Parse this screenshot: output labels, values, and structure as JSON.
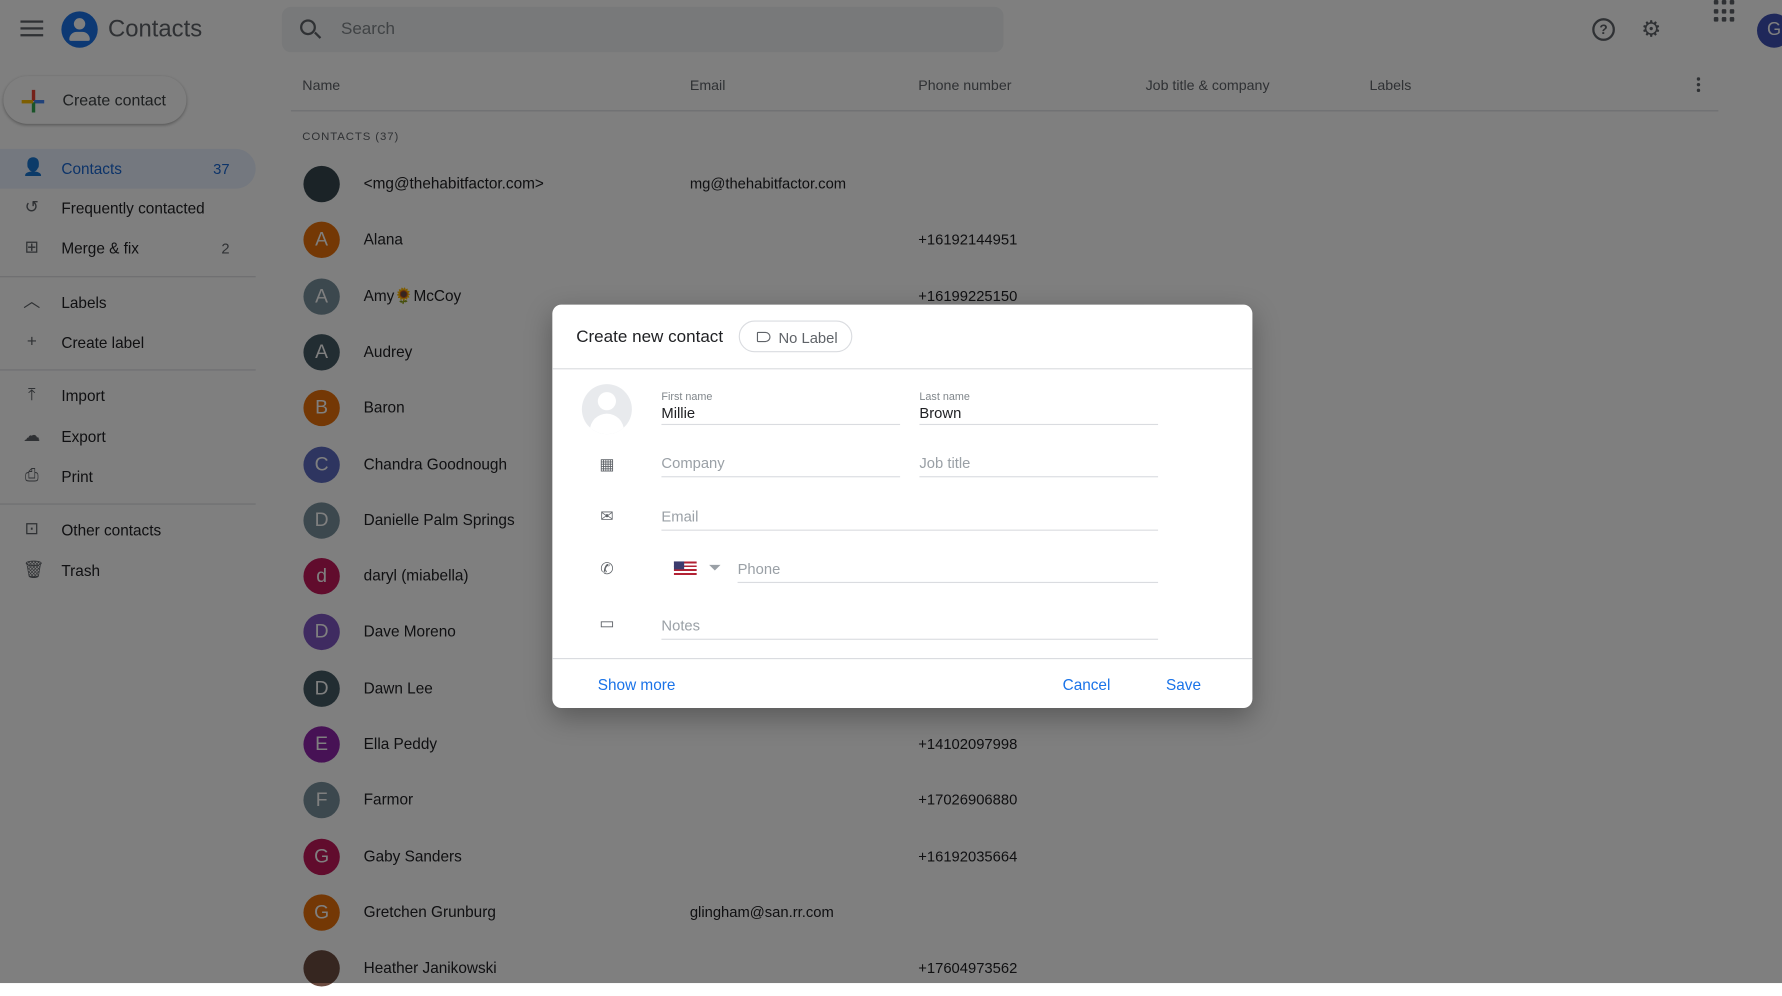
{
  "app": {
    "title": "Contacts",
    "search_placeholder": "Search",
    "account_initial": "G"
  },
  "sidebar": {
    "create_label": "Create contact",
    "items": [
      {
        "label": "Contacts",
        "count": "37",
        "icon": "person-icon"
      },
      {
        "label": "Frequently contacted",
        "count": "",
        "icon": "history-icon"
      },
      {
        "label": "Merge & fix",
        "count": "2",
        "icon": "merge-icon"
      },
      {
        "label": "Labels",
        "count": "",
        "icon": "chevron-up-icon"
      },
      {
        "label": "Create label",
        "count": "",
        "icon": "plus-icon"
      },
      {
        "label": "Import",
        "count": "",
        "icon": "upload-icon"
      },
      {
        "label": "Export",
        "count": "",
        "icon": "cloud-download-icon"
      },
      {
        "label": "Print",
        "count": "",
        "icon": "print-icon"
      },
      {
        "label": "Other contacts",
        "count": "",
        "icon": "archive-icon"
      },
      {
        "label": "Trash",
        "count": "",
        "icon": "trash-icon"
      }
    ]
  },
  "table": {
    "columns": [
      "Name",
      "Email",
      "Phone number",
      "Job title & company",
      "Labels"
    ],
    "section": "CONTACTS (37)",
    "rows": [
      {
        "initial": "",
        "name": "<mg@thehabitfactor.com>",
        "email": "mg@thehabitfactor.com",
        "phone": "",
        "color": "#37474f"
      },
      {
        "initial": "A",
        "name": "Alana",
        "email": "",
        "phone": "+16192144951",
        "color": "#e8710a"
      },
      {
        "initial": "A",
        "name": "Amy🌻McCoy",
        "email": "",
        "phone": "+16199225150",
        "color": "#78909c"
      },
      {
        "initial": "A",
        "name": "Audrey",
        "email": "",
        "phone": "",
        "color": "#455a64"
      },
      {
        "initial": "B",
        "name": "Baron",
        "email": "",
        "phone": "",
        "color": "#e8710a"
      },
      {
        "initial": "C",
        "name": "Chandra Goodnough",
        "email": "",
        "phone": "",
        "color": "#5c6bc0"
      },
      {
        "initial": "D",
        "name": "Danielle Palm Springs",
        "email": "",
        "phone": "",
        "color": "#78909c"
      },
      {
        "initial": "d",
        "name": "daryl (miabella)",
        "email": "",
        "phone": "",
        "color": "#c2185b"
      },
      {
        "initial": "D",
        "name": "Dave Moreno",
        "email": "",
        "phone": "",
        "color": "#7e57c2"
      },
      {
        "initial": "D",
        "name": "Dawn Lee",
        "email": "",
        "phone": "",
        "color": "#455a64"
      },
      {
        "initial": "E",
        "name": "Ella Peddy",
        "email": "",
        "phone": "+14102097998",
        "color": "#8e24aa"
      },
      {
        "initial": "F",
        "name": "Farmor",
        "email": "",
        "phone": "+17026906880",
        "color": "#78909c"
      },
      {
        "initial": "G",
        "name": "Gaby Sanders",
        "email": "",
        "phone": "+16192035664",
        "color": "#c2185b"
      },
      {
        "initial": "G",
        "name": "Gretchen Grunburg",
        "email": "glingham@san.rr.com",
        "phone": "",
        "color": "#e8710a"
      },
      {
        "initial": "",
        "name": "Heather Janikowski",
        "email": "",
        "phone": "+17604973562",
        "color": "#6d4c41"
      }
    ]
  },
  "dialog": {
    "title": "Create new contact",
    "label_chip": "No Label",
    "first_name_label": "First name",
    "first_name": "Millie",
    "last_name_label": "Last name",
    "last_name": "Brown",
    "company_placeholder": "Company",
    "job_title_placeholder": "Job title",
    "email_placeholder": "Email",
    "phone_placeholder": "Phone",
    "country": "US",
    "notes_placeholder": "Notes",
    "show_more": "Show more",
    "cancel": "Cancel",
    "save": "Save"
  }
}
